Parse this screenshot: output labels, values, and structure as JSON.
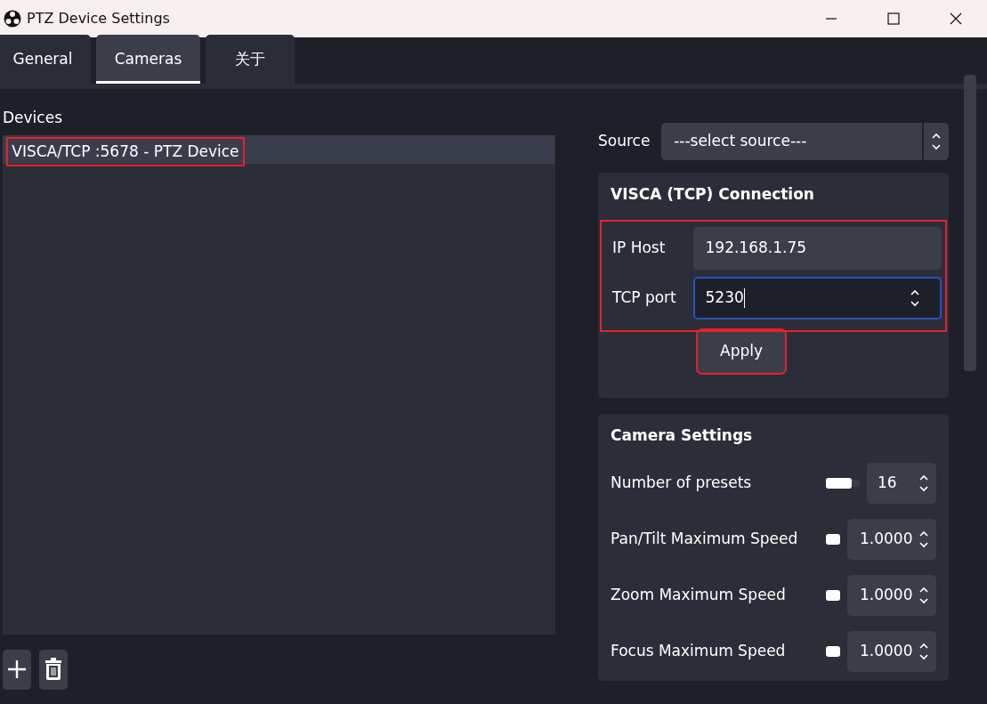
{
  "window": {
    "title": "PTZ Device Settings"
  },
  "tabs": [
    {
      "label": "General",
      "selected": false
    },
    {
      "label": "Cameras",
      "selected": true
    },
    {
      "label": "关于",
      "selected": false
    }
  ],
  "devices": {
    "label": "Devices",
    "items": [
      {
        "label": "VISCA/TCP :5678 - PTZ Device",
        "selected": true,
        "highlighted": true
      }
    ]
  },
  "source": {
    "label": "Source",
    "value": "---select source---"
  },
  "connection": {
    "title": "VISCA (TCP) Connection",
    "highlighted": true,
    "fields": [
      {
        "label": "IP Host",
        "value": "192.168.1.75",
        "kind": "text",
        "focused": false
      },
      {
        "label": "TCP port",
        "value": "5230",
        "kind": "spin",
        "focused": true
      }
    ],
    "apply": {
      "label": "Apply",
      "highlighted": true
    }
  },
  "camera_settings": {
    "title": "Camera Settings",
    "rows": [
      {
        "label": "Number of presets",
        "value": "16",
        "level": 0.78
      },
      {
        "label": "Pan/Tilt Maximum Speed",
        "value": "1.0000"
      },
      {
        "label": "Zoom Maximum Speed",
        "value": "1.0000"
      },
      {
        "label": "Focus Maximum Speed",
        "value": "1.0000"
      }
    ]
  }
}
